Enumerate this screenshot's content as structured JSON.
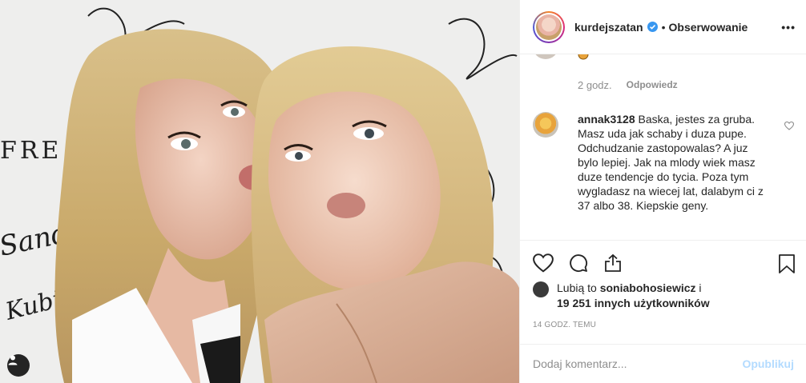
{
  "post": {
    "username": "kurdejszatan",
    "follow_label": "Obserwowanie",
    "separator": "•",
    "more_label": "•••",
    "photo": {
      "wall_text_partial": "FRE",
      "signature_text": "Sandra",
      "signature_text_2": "Kubicka"
    }
  },
  "previous_comment": {
    "time": "2 godz.",
    "reply_label": "Odpowiedz"
  },
  "comment": {
    "user": "annak3128",
    "text": "Baska, jestes za gruba. Masz uda jak schaby i duza pupe. Odchudzanie zastopowalas? A juz bylo lepiej. Jak na mlody wiek masz duze tendencje do tycia. Poza tym wygladasz na wiecej lat, dalabym ci z 37 albo 38. Kiepskie geny."
  },
  "likes": {
    "prefix": "Lubią to",
    "user": "soniabohosiewicz",
    "conj": "i",
    "others": "19 251 innych użytkowników"
  },
  "timestamp": "14 GODZ. TEMU",
  "comment_box": {
    "placeholder": "Dodaj komentarz...",
    "publish_label": "Opublikuj"
  },
  "icons": {
    "verified": "verified-badge-icon",
    "more": "more-options-icon",
    "heart": "heart-icon",
    "comment": "comment-icon",
    "share": "share-icon",
    "bookmark": "bookmark-icon",
    "tag": "user-tag-icon"
  },
  "colors": {
    "verified_blue": "#3897f0",
    "publish_disabled": "#b3dbff",
    "meta_gray": "#8e8e8e",
    "text": "#262626"
  }
}
